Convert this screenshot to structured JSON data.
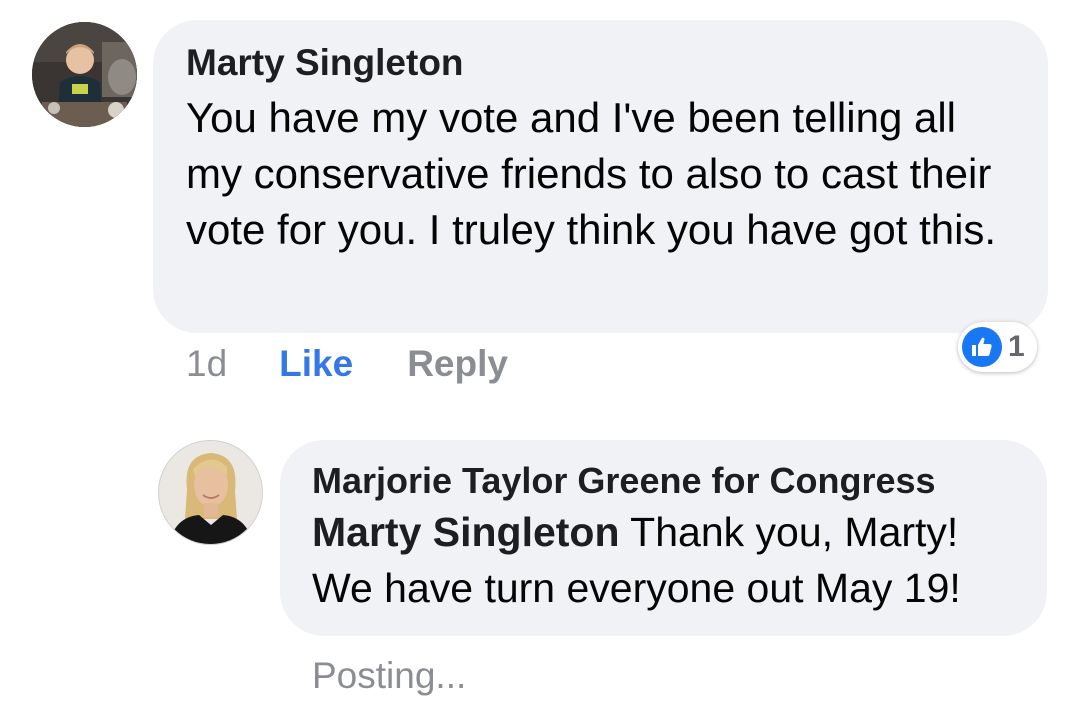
{
  "comments": [
    {
      "author": "Marty Singleton",
      "text": "You have my vote and I've been telling all my conservative friends to also to cast their vote for you. I truley think you have got this.",
      "time": "1d",
      "like_label": "Like",
      "reply_label": "Reply",
      "reaction_count": "1",
      "reaction_icon": "thumbs-up-icon",
      "avatar": "user-avatar"
    }
  ],
  "reply": {
    "author": "Marjorie Taylor Greene for Congress",
    "mention": "Marty Singleton",
    "text": " Thank you, Marty!",
    "text_line2": "We have turn everyone out May 19!",
    "status": "Posting...",
    "avatar": "page-avatar"
  },
  "colors": {
    "bubble_bg": "#f0f2f5",
    "like_blue": "#3578e5",
    "muted_gray": "#8a8d91",
    "reaction_blue": "#1877f2"
  }
}
